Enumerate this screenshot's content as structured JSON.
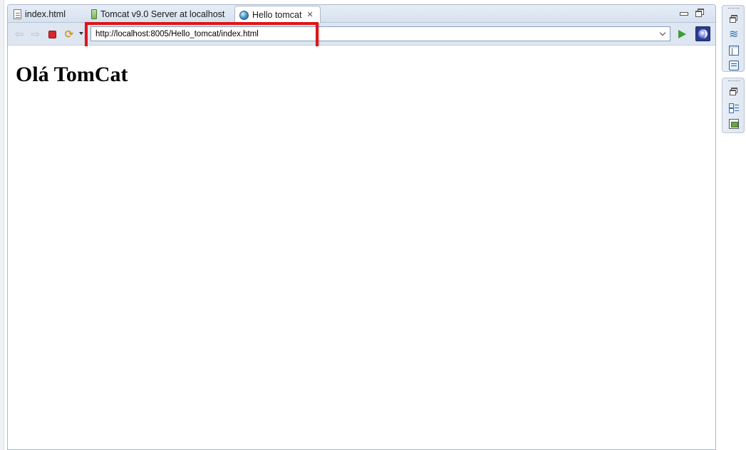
{
  "tabs": [
    {
      "label": "index.html",
      "icon": "html-file-icon",
      "active": false
    },
    {
      "label": "Tomcat v9.0 Server at localhost",
      "icon": "server-icon",
      "active": false
    },
    {
      "label": "Hello tomcat",
      "icon": "globe-icon",
      "active": true
    }
  ],
  "toolbar": {
    "back_icon": "back-arrow-icon",
    "forward_icon": "forward-arrow-icon",
    "stop_icon": "stop-icon",
    "refresh_icon": "refresh-icon",
    "url_value": "http://localhost:8005/Hello_tomcat/index.html",
    "go_icon": "go-icon",
    "eclipse_icon": "eclipse-icon"
  },
  "page": {
    "heading": "Olá TomCat"
  },
  "colors": {
    "highlight": "#e01414",
    "tabbar": "#d7e2ef",
    "toolbar": "#dde6f1"
  }
}
